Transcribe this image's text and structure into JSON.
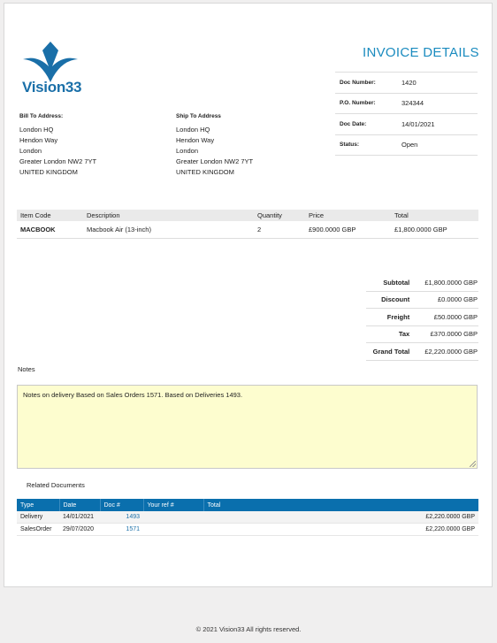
{
  "brand": {
    "logo_text": "Vision33"
  },
  "title": "INVOICE DETAILS",
  "details": [
    {
      "label": "Doc Number:",
      "value": "1420"
    },
    {
      "label": "P.O. Number:",
      "value": "324344"
    },
    {
      "label": "Doc Date:",
      "value": "14/01/2021"
    },
    {
      "label": "Status:",
      "value": "Open"
    }
  ],
  "bill_to": {
    "heading": "Bill To Address:",
    "lines": [
      "London HQ",
      "Hendon Way",
      "London",
      "Greater London NW2 7YT",
      "UNITED KINGDOM"
    ]
  },
  "ship_to": {
    "heading": "Ship To Address",
    "lines": [
      "London HQ",
      "Hendon Way",
      "London",
      "Greater London NW2 7YT",
      "UNITED KINGDOM"
    ]
  },
  "items": {
    "headers": [
      "Item Code",
      "Description",
      "Quantity",
      "Price",
      "Total"
    ],
    "rows": [
      [
        "MACBOOK",
        "Macbook Air (13-inch)",
        "2",
        "£900.0000 GBP",
        "£1,800.0000 GBP"
      ]
    ]
  },
  "totals": [
    {
      "label": "Subtotal",
      "value": "£1,800.0000 GBP"
    },
    {
      "label": "Discount",
      "value": "£0.0000 GBP"
    },
    {
      "label": "Freight",
      "value": "£50.0000 GBP"
    },
    {
      "label": "Tax",
      "value": "£370.0000 GBP"
    },
    {
      "label": "Grand Total",
      "value": "£2,220.0000 GBP"
    }
  ],
  "notes": {
    "label": "Notes",
    "text": "Notes on delivery Based on Sales Orders 1571. Based on Deliveries 1493."
  },
  "related": {
    "label": "Related Documents",
    "headers": [
      "Type",
      "Date",
      "Doc #",
      "Your ref #",
      "Total"
    ],
    "rows": [
      [
        "Delivery",
        "14/01/2021",
        "1493",
        "",
        "£2,220.0000 GBP"
      ],
      [
        "SalesOrder",
        "29/07/2020",
        "1571",
        "",
        "£2,220.0000 GBP"
      ]
    ]
  },
  "footer": "© 2021 Vision33 All rights reserved.",
  "colors": {
    "brand_blue": "#1a6fa8",
    "header_blue": "#0a6fad",
    "title_blue": "#1a8bbf",
    "notes_bg": "#fdfdcf"
  }
}
